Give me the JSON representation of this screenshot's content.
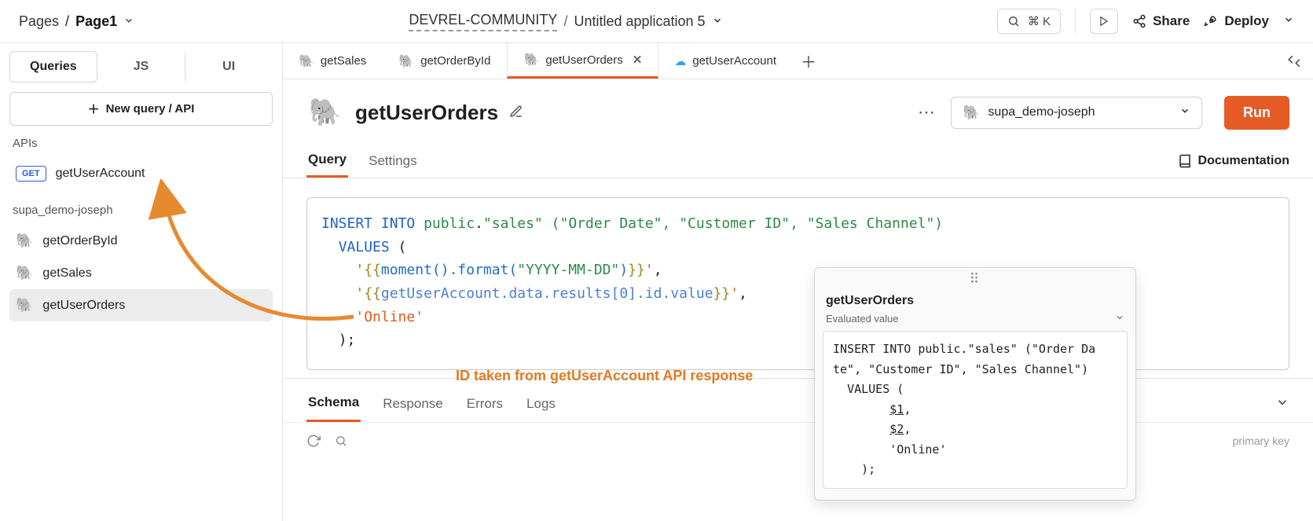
{
  "topbar": {
    "crumb1": "Pages",
    "crumb2": "Page1",
    "project": "DEVREL-COMMUNITY",
    "app": "Untitled application 5",
    "cmdk_combo": "⌘ K",
    "share": "Share",
    "deploy": "Deploy"
  },
  "sidebar": {
    "tabs": [
      "Queries",
      "JS",
      "UI"
    ],
    "new_query": "New query / API",
    "apis_label": "APIs",
    "apis": [
      {
        "badge": "GET",
        "name": "getUserAccount"
      }
    ],
    "ds_label": "supa_demo-joseph",
    "ds_queries": [
      "getOrderById",
      "getSales",
      "getUserOrders"
    ]
  },
  "filetabs": {
    "items": [
      {
        "icon": "pg",
        "label": "getSales"
      },
      {
        "icon": "pg",
        "label": "getOrderById"
      },
      {
        "icon": "pg",
        "label": "getUserOrders",
        "active": true,
        "closable": true
      },
      {
        "icon": "cloud",
        "label": "getUserAccount"
      }
    ]
  },
  "qheader": {
    "title": "getUserOrders",
    "db_name": "supa_demo-joseph",
    "run": "Run"
  },
  "qtabs": {
    "query": "Query",
    "settings": "Settings",
    "docs": "Documentation"
  },
  "editor": {
    "kw_insert": "INSERT INTO",
    "schema": "public",
    "table": "\"sales\"",
    "cols": "(\"Order Date\", \"Customer ID\", \"Sales Channel\")",
    "kw_values": "VALUES",
    "lp": " (",
    "q": "'",
    "ob": "{{",
    "cb": "}}",
    "moment": "moment().format(",
    "fmt": "\"YYYY-MM-DD\"",
    "mclose": ")",
    "comma": ",",
    "path": "getUserAccount.data.results[0].id.value",
    "online": "'Online'",
    "end": ");"
  },
  "annotation": "ID taken from getUserAccount API response",
  "popover": {
    "title": "getUserOrders",
    "sub": "Evaluated value",
    "body": "INSERT INTO public.\"sales\" (\"Order Da\nte\", \"Customer ID\", \"Sales Channel\")\n  VALUES (\n        $1,\n        $2,\n        'Online'\n    );"
  },
  "resulttabs": {
    "schema": "Schema",
    "response": "Response",
    "errors": "Errors",
    "logs": "Logs"
  },
  "schema_footer": {
    "primary_key": "primary key"
  }
}
